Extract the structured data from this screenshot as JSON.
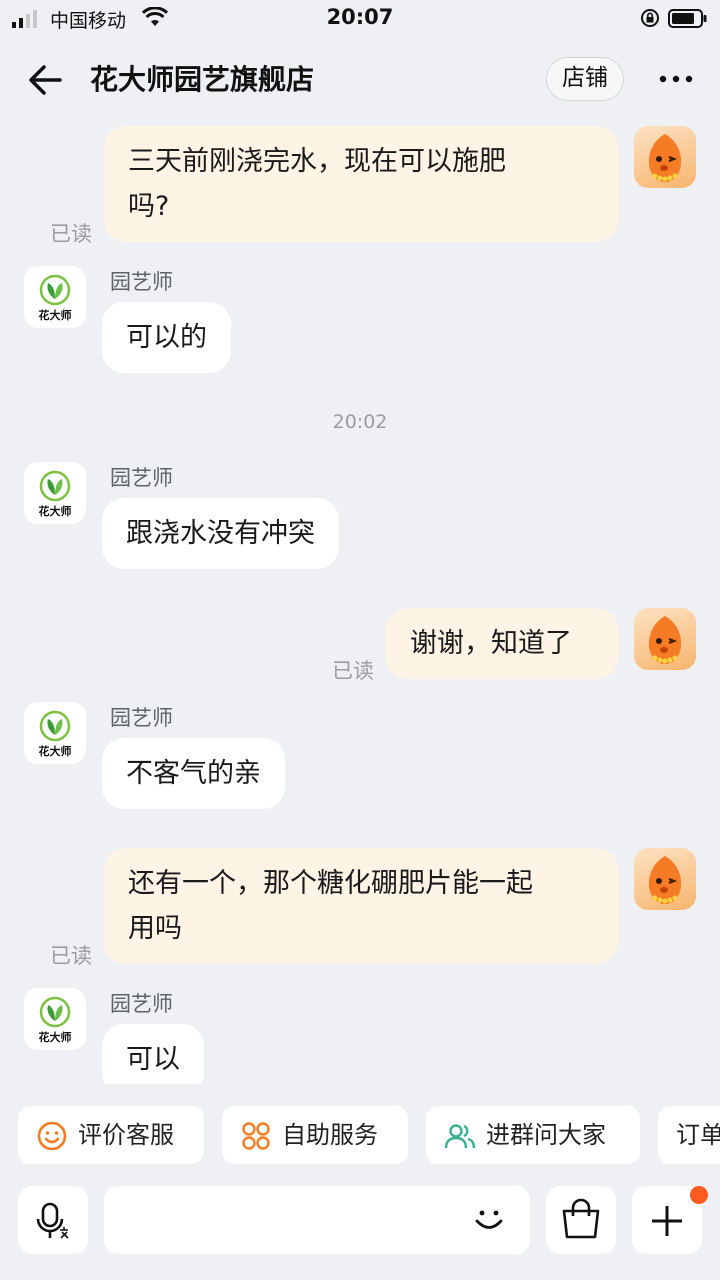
{
  "status_bar": {
    "carrier": "中国移动",
    "time": "20:07"
  },
  "header": {
    "title": "花大师园艺旗舰店",
    "shop_button": "店铺"
  },
  "shop_avatar_text": "花大师",
  "messages": [
    {
      "side": "right",
      "text_lines": [
        "三天前刚浇完水，现在可以施肥",
        "吗?"
      ],
      "status": "已读"
    },
    {
      "side": "left",
      "sender": "园艺师",
      "text": "可以的"
    },
    {
      "side": "left",
      "sender": "园艺师",
      "text": "跟浇水没有冲突"
    },
    {
      "side": "right",
      "text": "谢谢，知道了",
      "status": "已读"
    },
    {
      "side": "left",
      "sender": "园艺师",
      "text": "不客气的亲"
    },
    {
      "side": "right",
      "text_lines": [
        "还有一个，那个糖化硼肥片能一起",
        "用吗"
      ],
      "status": "已读"
    },
    {
      "side": "left",
      "sender": "园艺师",
      "text": "可以"
    }
  ],
  "timestamp": "20:02",
  "quick_actions": [
    {
      "label": "评价客服",
      "icon": "smile-face-icon"
    },
    {
      "label": "自助服务",
      "icon": "grid-apps-icon"
    },
    {
      "label": "进群问大家",
      "icon": "group-users-icon"
    },
    {
      "label": "订单",
      "icon": "order-icon"
    }
  ],
  "input": {
    "placeholder": "",
    "value": ""
  },
  "colors": {
    "background": "#EEF0F3",
    "user_bubble": "#FEF4E5",
    "shop_bubble": "#FFFFFF",
    "accent_orange": "#F57C24",
    "accent_green": "#3BB08F",
    "notification_dot": "#FF5A1F"
  }
}
